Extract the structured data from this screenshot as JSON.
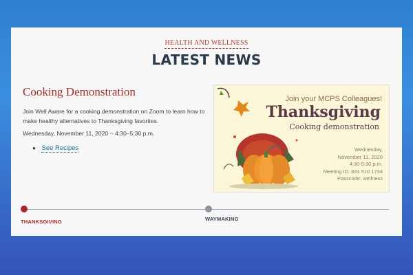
{
  "section": {
    "kicker": "HEALTH AND WELLNESS",
    "headline": "LATEST NEWS"
  },
  "article": {
    "title": "Cooking Demonstration",
    "body": "Join Well Aware for a cooking demonstration on Zoom to learn how to make healthy alternatives to Thanksgiving favorites.",
    "date": "Wednesday, November 11, 2020 ~ 4:30–5:30 p.m.",
    "links": [
      {
        "label": "See Recipes"
      }
    ]
  },
  "flyer": {
    "line1": "Join your MCPS Colleagues!",
    "title": "Thanksgiving",
    "subtitle": "Cooking demonstration",
    "info": [
      "Wednesday,",
      "November 11, 2020",
      "4:30-5:30 p.m.",
      "Meeting ID: 831 510 1734",
      "Passcode: wellness"
    ]
  },
  "timeline": {
    "items": [
      {
        "label": "THANKSGIVING",
        "active": true
      },
      {
        "label": "WAYMAKING",
        "active": false
      }
    ]
  },
  "colors": {
    "accent": "#a82828",
    "headline": "#2b3a4a",
    "link": "#1a6f8f"
  }
}
